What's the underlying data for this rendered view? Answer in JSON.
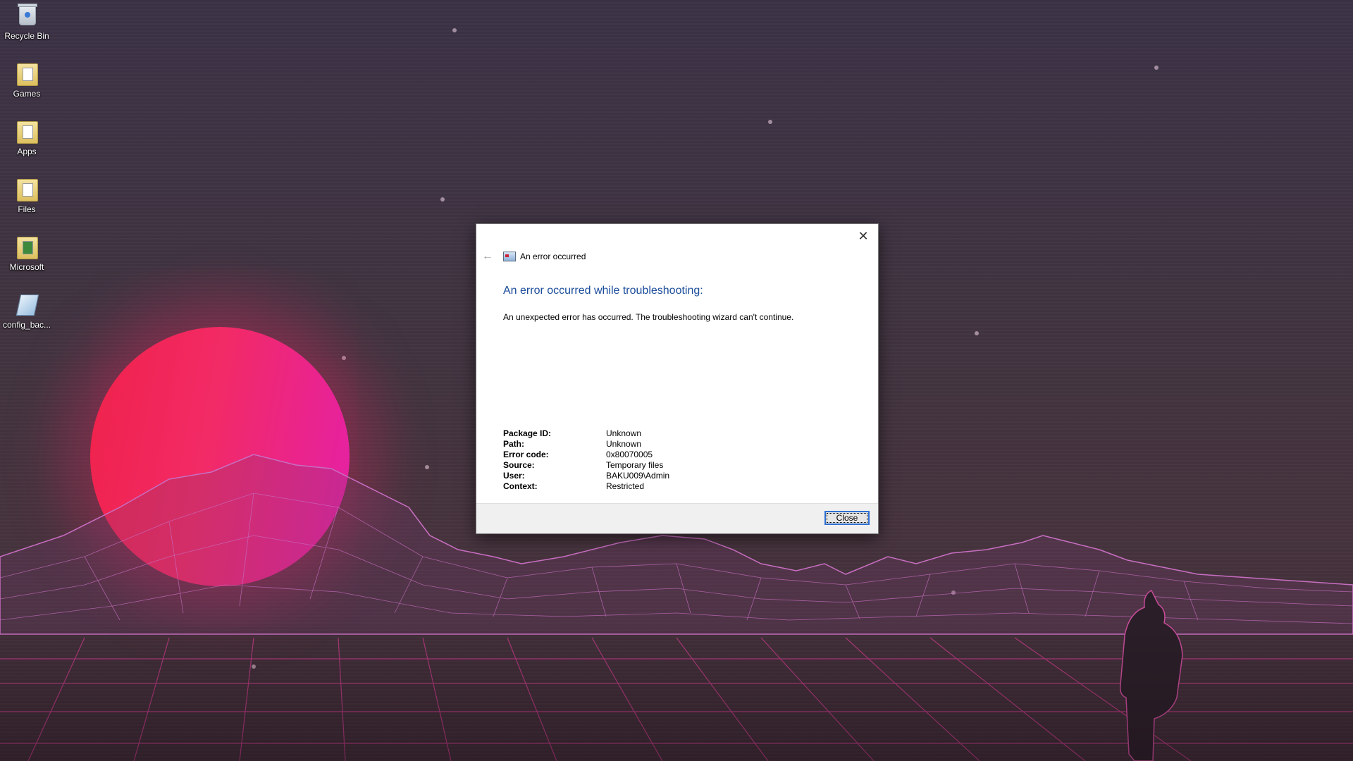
{
  "desktop": {
    "icons": [
      {
        "label": "Recycle Bin",
        "icon": "recycle-bin-icon"
      },
      {
        "label": "Games",
        "icon": "folder-icon"
      },
      {
        "label": "Apps",
        "icon": "folder-icon"
      },
      {
        "label": "Files",
        "icon": "folder-icon"
      },
      {
        "label": "Microsoft",
        "icon": "folder-icon"
      },
      {
        "label": "config_bac...",
        "icon": "config-file-icon"
      }
    ]
  },
  "dialog": {
    "window_title": "An error occurred",
    "heading": "An error occurred while troubleshooting:",
    "message": "An unexpected error has occurred. The troubleshooting wizard can't continue.",
    "details": [
      {
        "key": "Package ID:",
        "value": "Unknown"
      },
      {
        "key": "Path:",
        "value": "Unknown"
      },
      {
        "key": "Error code:",
        "value": "0x80070005"
      },
      {
        "key": "Source:",
        "value": "Temporary files"
      },
      {
        "key": "User:",
        "value": "BAKU009\\Admin"
      },
      {
        "key": "Context:",
        "value": "Restricted"
      }
    ],
    "close_button": "Close"
  },
  "colors": {
    "heading_blue": "#1a4c9a",
    "button_focus": "#2e6fd1",
    "sun_red": "#f0224a",
    "sun_magenta": "#e420a8"
  }
}
